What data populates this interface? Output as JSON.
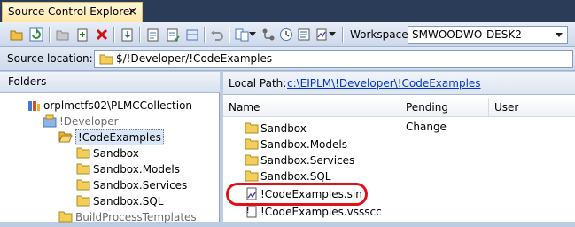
{
  "tab": {
    "title": "Source Control Explorer",
    "close": "×"
  },
  "toolbar": {
    "workspace_label": "Workspace:",
    "workspace_value": "SMWOODWO-DESK2"
  },
  "source_location": {
    "label": "Source location:",
    "path": "$/!Developer/!CodeExamples"
  },
  "folders": {
    "header": "Folders",
    "tree": [
      {
        "label": "orplmctfs02\\PLMCCollection",
        "icon": "server-collection-icon"
      },
      {
        "label": "!Developer",
        "icon": "team-project-icon"
      },
      {
        "label": "!CodeExamples",
        "icon": "folder-open-icon",
        "selected": true
      },
      {
        "label": "Sandbox",
        "icon": "folder-icon"
      },
      {
        "label": "Sandbox.Models",
        "icon": "folder-icon"
      },
      {
        "label": "Sandbox.Services",
        "icon": "folder-icon"
      },
      {
        "label": "Sandbox.SQL",
        "icon": "folder-icon"
      },
      {
        "label": "BuildProcessTemplates",
        "icon": "folder-icon"
      }
    ]
  },
  "right": {
    "local_path_label": "Local Path:",
    "local_path_link": "c:\\EIPLM\\!Developer\\!CodeExamples",
    "columns": [
      "Name",
      "Pending Change",
      "User"
    ],
    "files": [
      {
        "name": "Sandbox",
        "icon": "folder-icon"
      },
      {
        "name": "Sandbox.Models",
        "icon": "folder-icon"
      },
      {
        "name": "Sandbox.Services",
        "icon": "folder-icon"
      },
      {
        "name": "Sandbox.SQL",
        "icon": "folder-icon"
      },
      {
        "name": "!CodeExamples.sln",
        "icon": "solution-file-icon",
        "highlighted": true
      },
      {
        "name": "!CodeExamples.vssscc",
        "icon": "vssscc-file-icon"
      }
    ]
  },
  "colors": {
    "highlight": "#e3101a",
    "link": "#0033cc",
    "chrome": "#bccde3"
  }
}
